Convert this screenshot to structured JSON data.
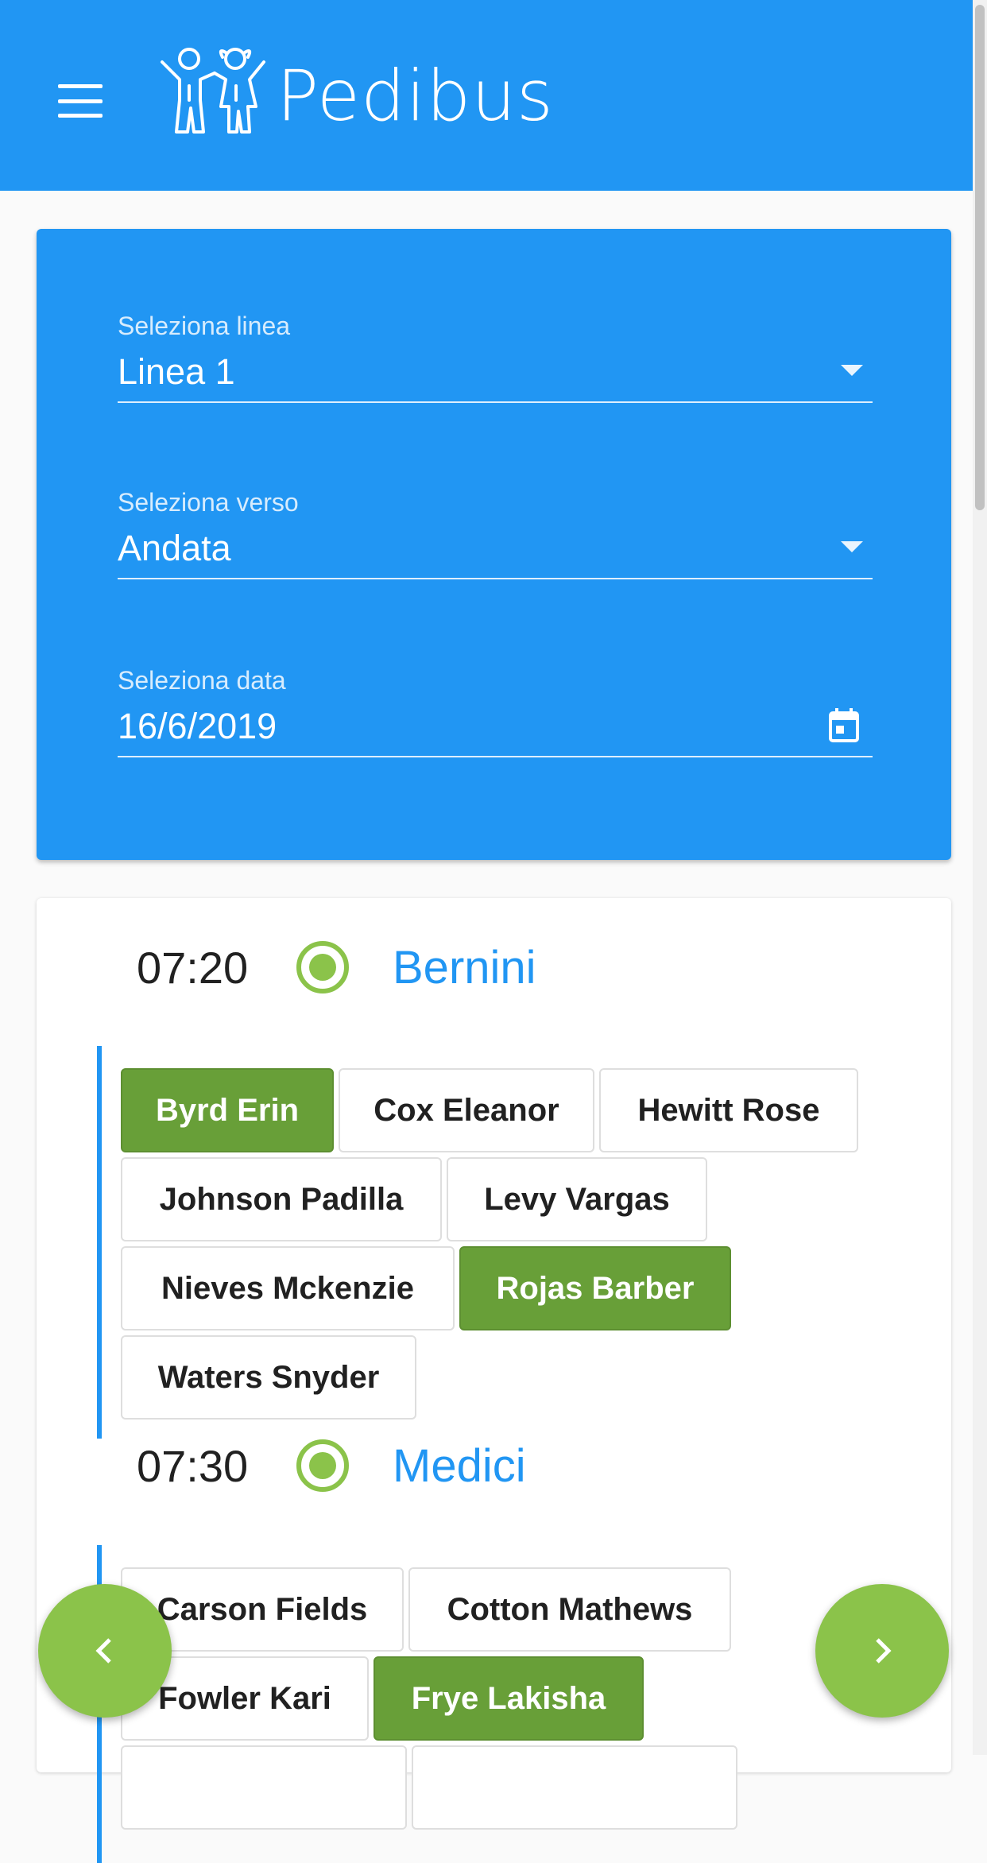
{
  "app": {
    "title": "Pedibus"
  },
  "filters": {
    "line": {
      "label": "Seleziona linea",
      "value": "Linea 1"
    },
    "direction": {
      "label": "Seleziona verso",
      "value": "Andata"
    },
    "date": {
      "label": "Seleziona data",
      "value": "16/6/2019"
    }
  },
  "stops": [
    {
      "time": "07:20",
      "name": "Bernini",
      "children": [
        {
          "name": "Byrd Erin",
          "selected": true
        },
        {
          "name": "Cox Eleanor",
          "selected": false
        },
        {
          "name": "Hewitt Rose",
          "selected": false
        },
        {
          "name": "Johnson Padilla",
          "selected": false
        },
        {
          "name": "Levy Vargas",
          "selected": false
        },
        {
          "name": "Nieves Mckenzie",
          "selected": false
        },
        {
          "name": "Rojas Barber",
          "selected": true
        },
        {
          "name": "Waters Snyder",
          "selected": false
        }
      ]
    },
    {
      "time": "07:30",
      "name": "Medici",
      "children": [
        {
          "name": "Carson Fields",
          "selected": false
        },
        {
          "name": "Cotton Mathews",
          "selected": false
        },
        {
          "name": "Fowler Kari",
          "selected": false
        },
        {
          "name": "Frye Lakisha",
          "selected": true
        }
      ]
    }
  ],
  "colors": {
    "primary": "#2196f3",
    "selected_chip": "#689f38",
    "fab": "#8bc34a",
    "stop_dot": "#8bc34a"
  },
  "icons": {
    "menu": "menu-icon",
    "logo": "children-logo-icon",
    "calendar": "calendar-icon",
    "prev": "chevron-left-icon",
    "next": "chevron-right-icon"
  }
}
